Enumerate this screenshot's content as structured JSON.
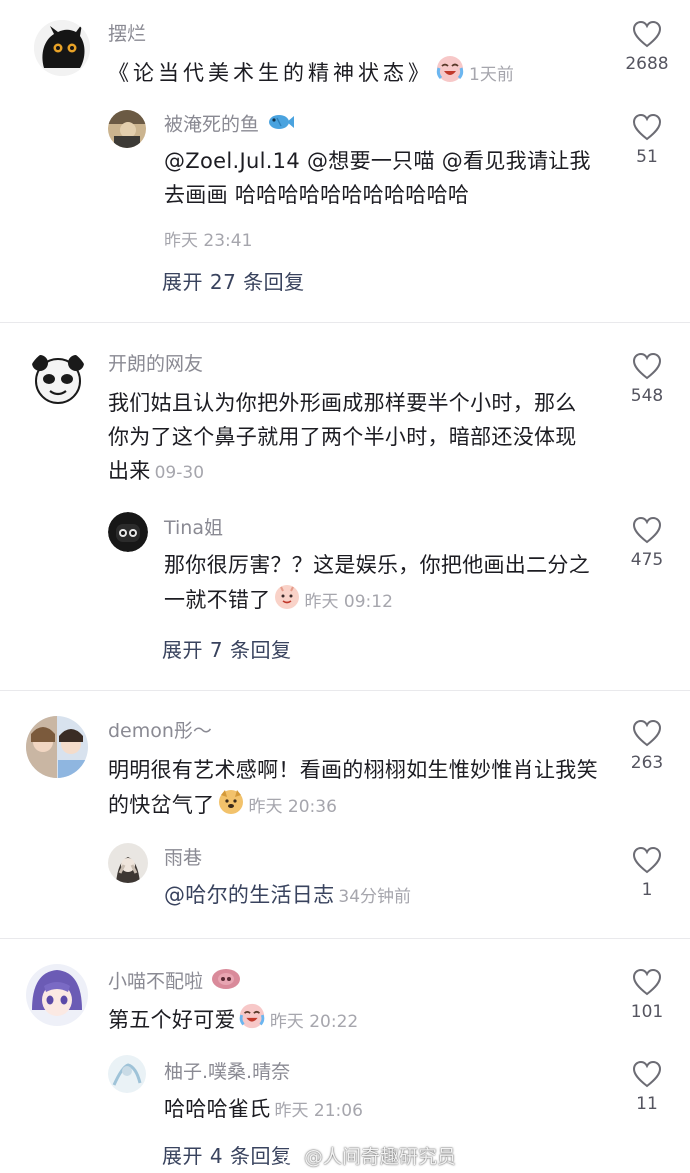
{
  "threads": [
    {
      "comment": {
        "username": "摆烂",
        "text": "《论当代美术生的精神状态》",
        "time": "1天前",
        "likes": "2688",
        "emoji": "crying-laugh-emoji"
      },
      "reply": {
        "username": "被淹死的鱼",
        "username_emoji": "fish-emoji",
        "text": "@Zoel.Jul.14 @想要一只喵 @看见我请让我去画画 哈哈哈哈哈哈哈哈哈哈哈",
        "time": "昨天 23:41",
        "likes": "51"
      },
      "expand_label": "展开 27 条回复"
    },
    {
      "comment": {
        "username": "开朗的网友",
        "text": "我们姑且认为你把外形画成那样要半个小时，那么你为了这个鼻子就用了两个半小时，暗部还没体现出来",
        "time": "09-30",
        "likes": "548"
      },
      "reply": {
        "username": "Tina姐",
        "text": "那你很厉害？？这是娱乐，你把他画出二分之一就不错了",
        "time": "昨天 09:12",
        "likes": "475",
        "emoji": "smile-pig-emoji"
      },
      "expand_label": "展开 7 条回复"
    },
    {
      "comment": {
        "username": "demon彤～",
        "text": "明明很有艺术感啊！看画的栩栩如生惟妙惟肖让我笑的快岔气了",
        "time": "昨天 20:36",
        "likes": "263",
        "emoji": "dog-emoji"
      },
      "reply": {
        "username": "雨巷",
        "text": "@哈尔的生活日志",
        "time": "34分钟前",
        "likes": "1"
      }
    },
    {
      "comment": {
        "username": "小喵不配啦",
        "username_emoji": "pig-nose-emoji",
        "text": "第五个好可爱",
        "time": "昨天 20:22",
        "likes": "101",
        "emoji": "crying-laugh-emoji"
      },
      "reply": {
        "username": "柚子.噗桑.晴奈",
        "text": "哈哈哈雀氏",
        "time": "昨天 21:06",
        "likes": "11"
      },
      "expand_label": "展开 4 条回复"
    }
  ],
  "watermark": "@人间奇趣研究员",
  "colors": {
    "username": "#8a8a93",
    "time": "#a6a6ad",
    "expand": "#39435e",
    "divider": "#e9e9ec"
  }
}
